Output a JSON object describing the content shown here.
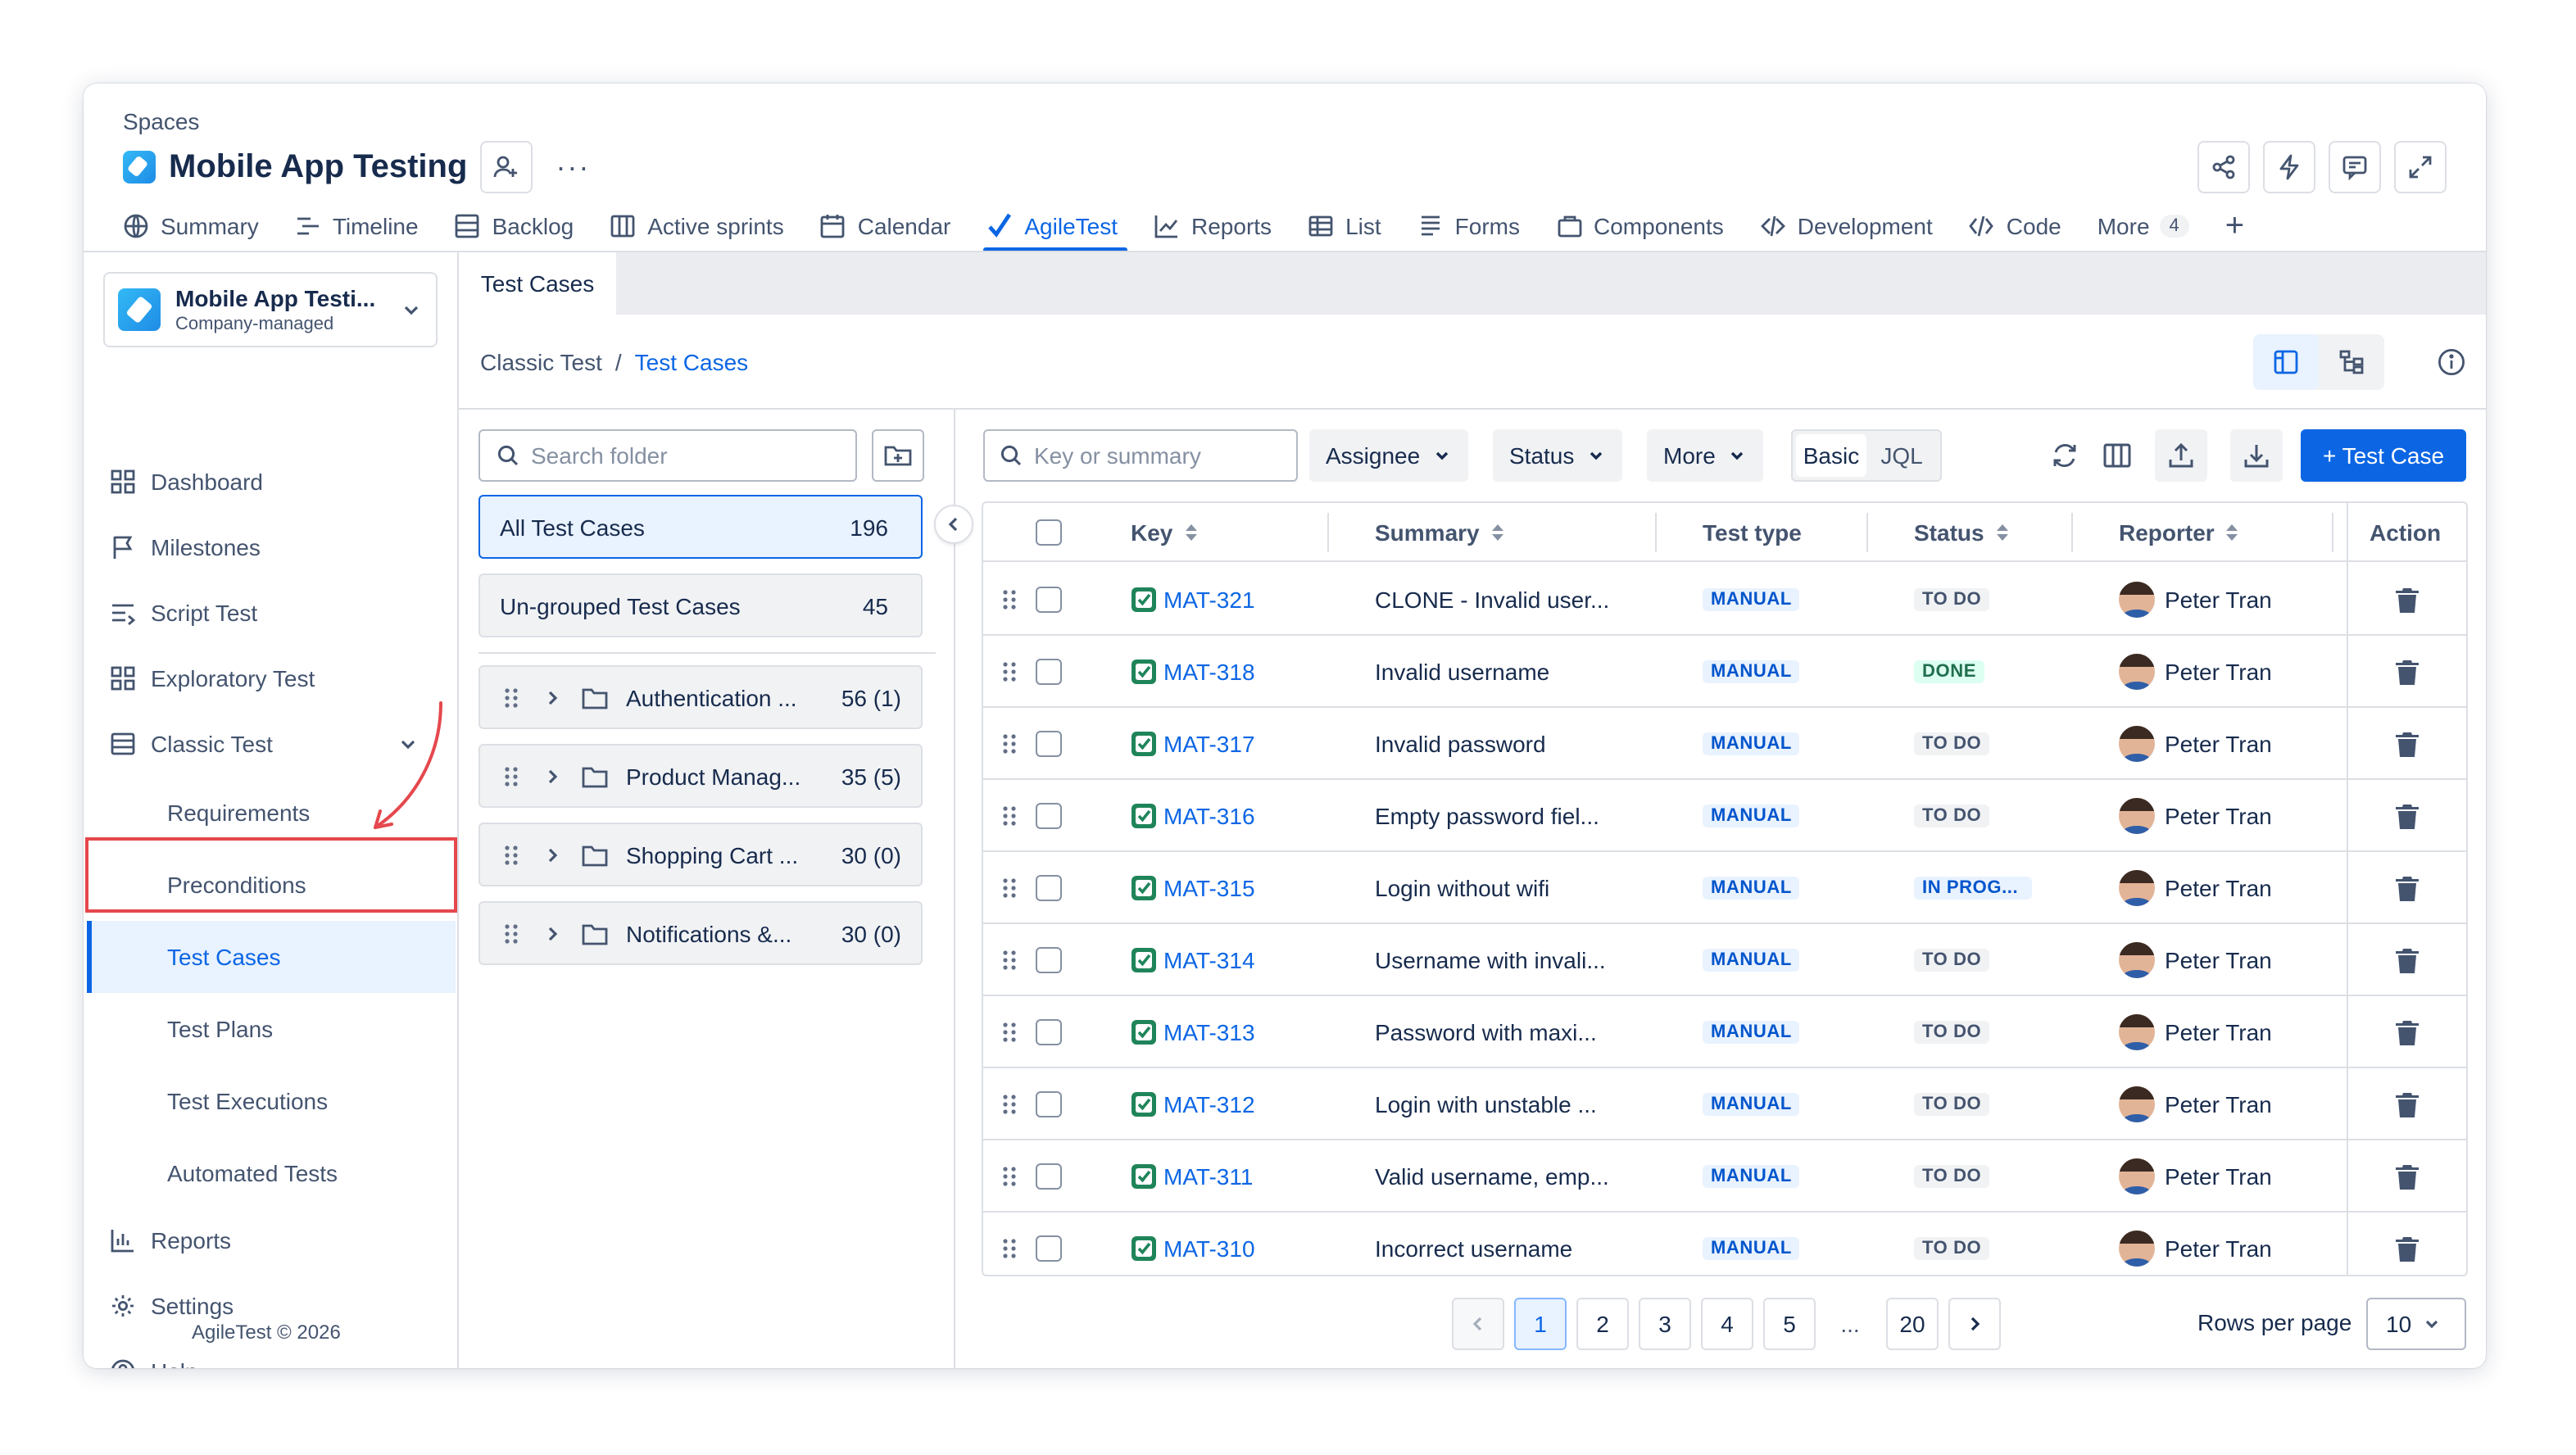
{
  "header": {
    "spaces_label": "Spaces",
    "project_title": "Mobile App Testing",
    "more_dots": "···"
  },
  "nav": {
    "tabs": [
      {
        "label": "Summary",
        "icon": "globe-icon"
      },
      {
        "label": "Timeline",
        "icon": "timeline-icon"
      },
      {
        "label": "Backlog",
        "icon": "backlog-icon"
      },
      {
        "label": "Active sprints",
        "icon": "board-icon"
      },
      {
        "label": "Calendar",
        "icon": "calendar-icon"
      },
      {
        "label": "AgileTest",
        "icon": "checkmark-icon"
      },
      {
        "label": "Reports",
        "icon": "chart-line-icon"
      },
      {
        "label": "List",
        "icon": "list-icon"
      },
      {
        "label": "Forms",
        "icon": "forms-icon"
      },
      {
        "label": "Components",
        "icon": "components-icon"
      },
      {
        "label": "Development",
        "icon": "code-branch-icon"
      },
      {
        "label": "Code",
        "icon": "code-icon"
      }
    ],
    "more_label": "More",
    "more_count": "4",
    "plus": "+",
    "active": "AgileTest"
  },
  "sidebar": {
    "project_name": "Mobile App Testi...",
    "project_type": "Company-managed",
    "items": {
      "dashboard": "Dashboard",
      "milestones": "Milestones",
      "script_test": "Script Test",
      "exploratory_test": "Exploratory Test",
      "classic_test": "Classic Test",
      "reports": "Reports",
      "settings": "Settings",
      "help": "Help"
    },
    "sub_items": {
      "requirements": "Requirements",
      "preconditions": "Preconditions",
      "test_cases": "Test Cases",
      "test_plans": "Test Plans",
      "test_executions": "Test Executions",
      "automated_tests": "Automated Tests"
    },
    "footer": "AgileTest © 2026"
  },
  "main": {
    "tab_label": "Test Cases",
    "breadcrumb": {
      "parent": "Classic Test",
      "separator": "/",
      "current": "Test Cases"
    }
  },
  "folders": {
    "search_placeholder": "Search folder",
    "all": {
      "label": "All Test Cases",
      "count": "196"
    },
    "ungrouped": {
      "label": "Un-grouped Test Cases",
      "count": "45"
    },
    "list": [
      {
        "name": "Authentication ...",
        "count": "56 (1)"
      },
      {
        "name": "Product Manag...",
        "count": "35 (5)"
      },
      {
        "name": "Shopping Cart ...",
        "count": "30 (0)"
      },
      {
        "name": "Notifications &...",
        "count": "30 (0)"
      }
    ]
  },
  "toolbar": {
    "search_placeholder": "Key or summary",
    "assignee": "Assignee",
    "status": "Status",
    "more": "More",
    "mode_basic": "Basic",
    "mode_jql": "JQL",
    "add_label": "+ Test Case"
  },
  "table": {
    "headers": {
      "key": "Key",
      "summary": "Summary",
      "test_type": "Test type",
      "status": "Status",
      "reporter": "Reporter",
      "action": "Action"
    },
    "rows": [
      {
        "key": "MAT-321",
        "summary": "CLONE - Invalid user...",
        "type": "MANUAL",
        "status": "TO DO",
        "reporter": "Peter Tran"
      },
      {
        "key": "MAT-318",
        "summary": "Invalid username",
        "type": "MANUAL",
        "status": "DONE",
        "reporter": "Peter Tran"
      },
      {
        "key": "MAT-317",
        "summary": "Invalid password",
        "type": "MANUAL",
        "status": "TO DO",
        "reporter": "Peter Tran"
      },
      {
        "key": "MAT-316",
        "summary": "Empty password fiel...",
        "type": "MANUAL",
        "status": "TO DO",
        "reporter": "Peter Tran"
      },
      {
        "key": "MAT-315",
        "summary": "Login without wifi",
        "type": "MANUAL",
        "status": "IN PROG...",
        "reporter": "Peter Tran"
      },
      {
        "key": "MAT-314",
        "summary": "Username with invali...",
        "type": "MANUAL",
        "status": "TO DO",
        "reporter": "Peter Tran"
      },
      {
        "key": "MAT-313",
        "summary": "Password with maxi...",
        "type": "MANUAL",
        "status": "TO DO",
        "reporter": "Peter Tran"
      },
      {
        "key": "MAT-312",
        "summary": "Login with unstable ...",
        "type": "MANUAL",
        "status": "TO DO",
        "reporter": "Peter Tran"
      },
      {
        "key": "MAT-311",
        "summary": "Valid username, emp...",
        "type": "MANUAL",
        "status": "TO DO",
        "reporter": "Peter Tran"
      },
      {
        "key": "MAT-310",
        "summary": "Incorrect username",
        "type": "MANUAL",
        "status": "TO DO",
        "reporter": "Peter Tran"
      }
    ]
  },
  "pagination": {
    "pages": [
      "1",
      "2",
      "3",
      "4",
      "5"
    ],
    "ellipsis": "...",
    "last": "20",
    "current": "1",
    "rows_label": "Rows per page",
    "rows_value": "10"
  },
  "colors": {
    "accent": "#0c66e4",
    "highlight_annotation": "#e5484d",
    "done_green": "#216e4e"
  }
}
